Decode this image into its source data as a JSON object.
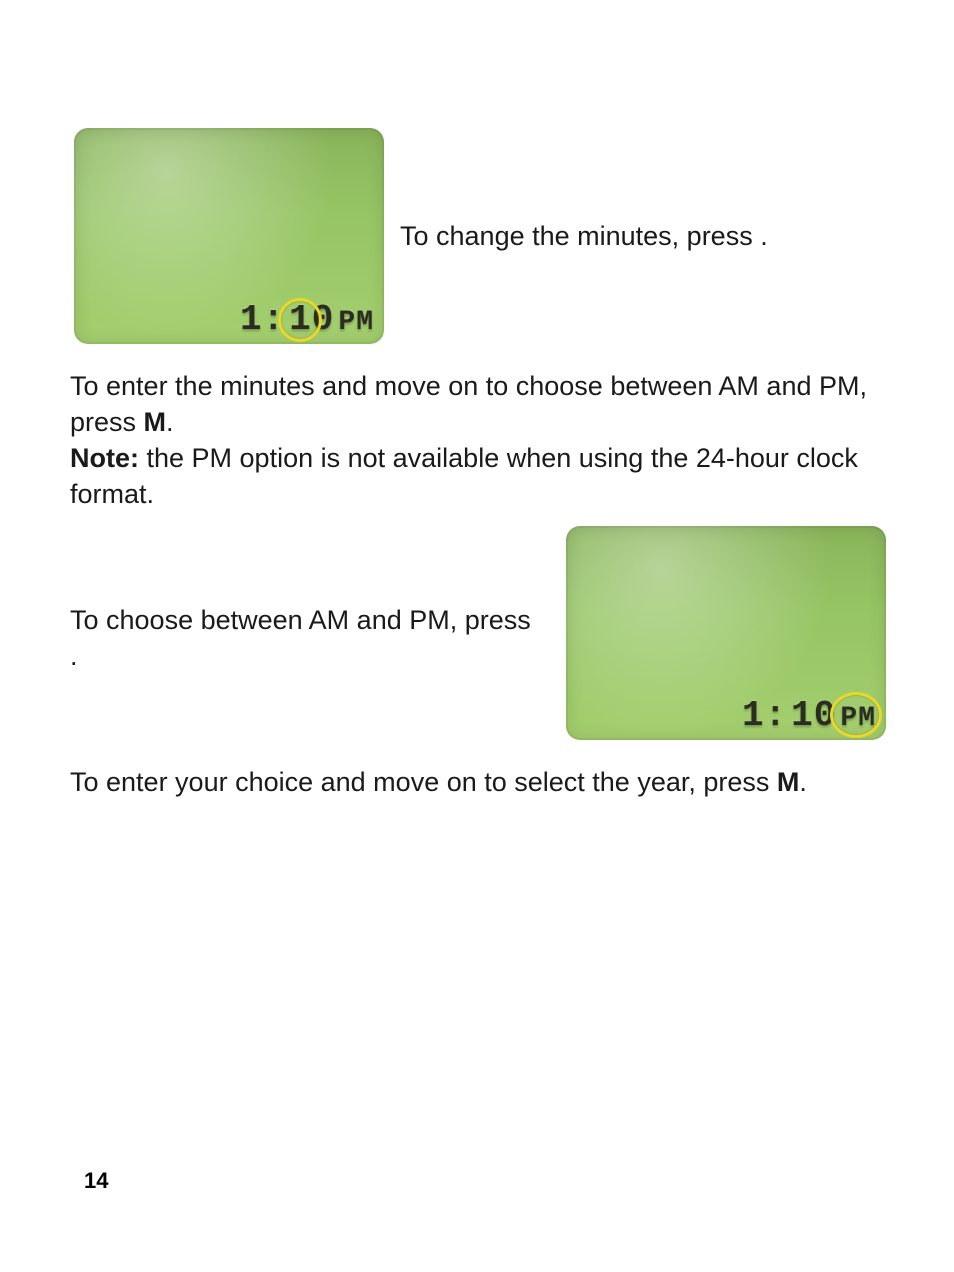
{
  "page_number": "14",
  "lcd1": {
    "hour": "1:",
    "minutes": "10",
    "ampm": "PM"
  },
  "lcd2": {
    "hour": "1:",
    "minutes": "10",
    "ampm": "PM"
  },
  "text": {
    "p1_a": "To change the minutes, press ",
    "p1_b": " .",
    "p2_a": "To enter the minutes and move on to choose between AM and PM, press ",
    "p2_m": "M",
    "p2_b": ".",
    "p3_label": "Note:",
    "p3_body": " the PM option is not available when using the 24-hour clock format.",
    "p4_a": "To choose between AM and PM, press ",
    "p4_b": " .",
    "p5_a": "To enter your choice and move on to select the year, press ",
    "p5_m": "M",
    "p5_b": "."
  }
}
